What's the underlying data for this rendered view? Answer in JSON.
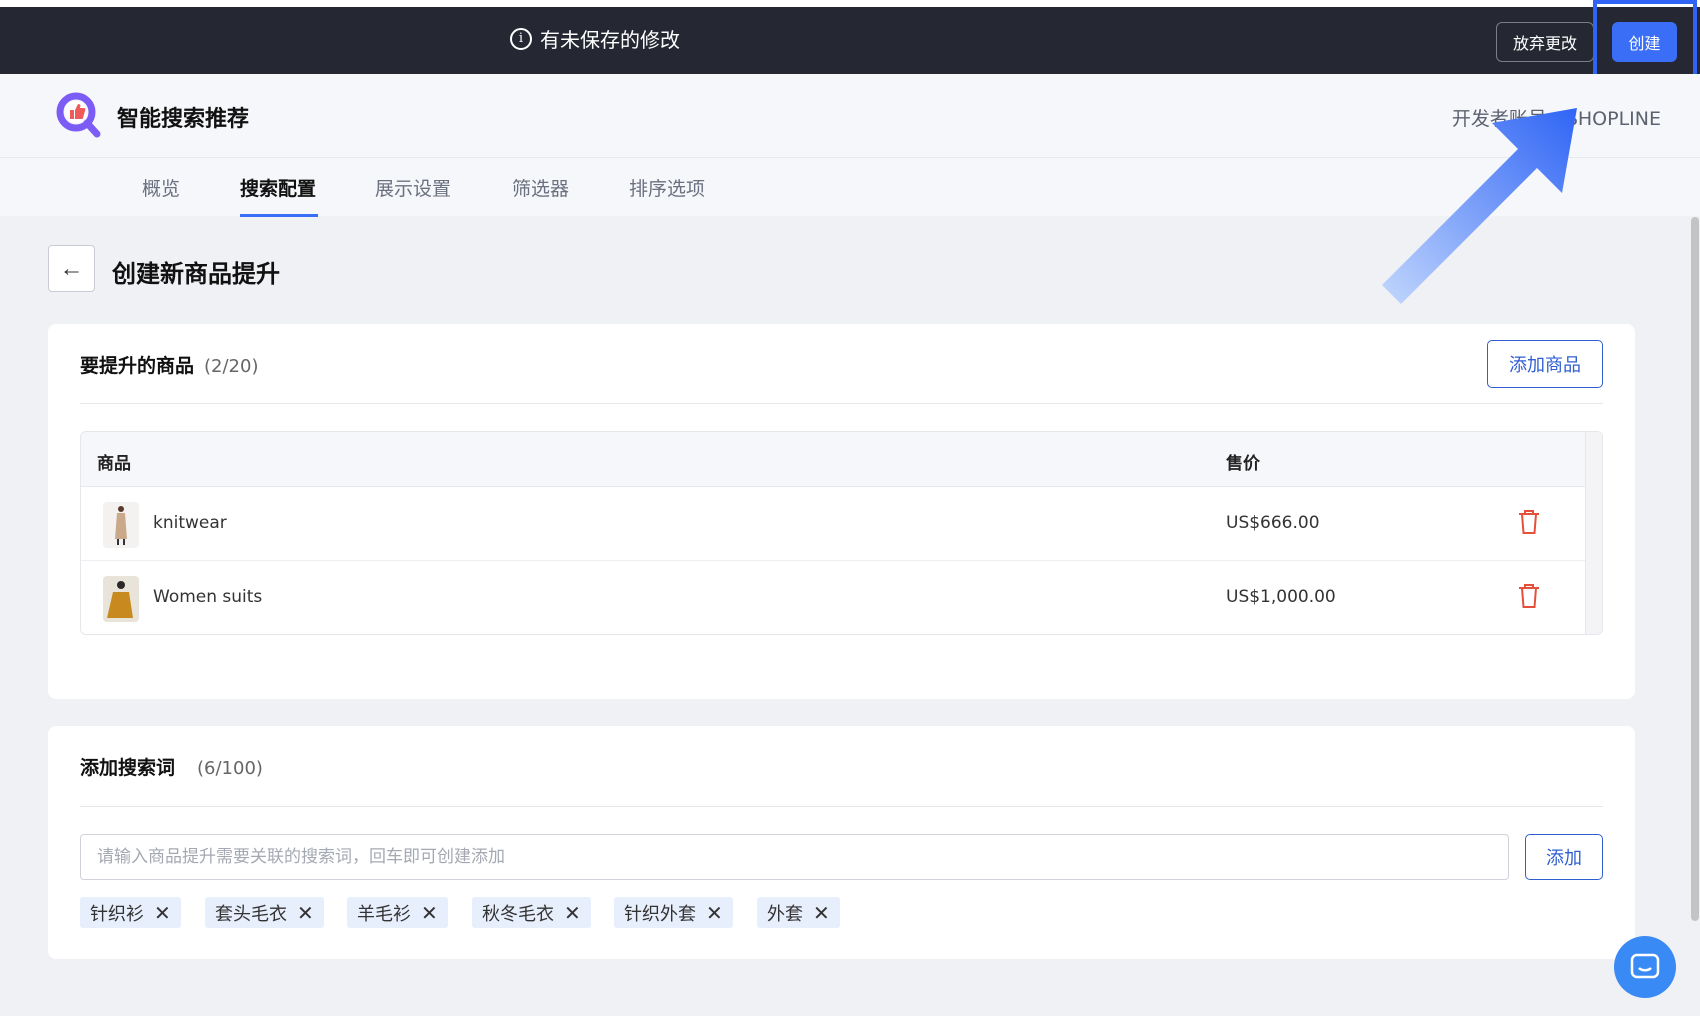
{
  "topbar": {
    "unsaved_text": "有未保存的修改",
    "discard_label": "放弃更改",
    "create_label": "创建"
  },
  "header": {
    "app_title": "智能搜索推荐",
    "developer": "开发者账号：SHOPLINE"
  },
  "tabs": [
    {
      "label": "概览"
    },
    {
      "label": "搜索配置",
      "active": true
    },
    {
      "label": "展示设置"
    },
    {
      "label": "筛选器"
    },
    {
      "label": "排序选项"
    }
  ],
  "page": {
    "title": "创建新商品提升"
  },
  "products_card": {
    "title": "要提升的商品",
    "count": "(2/20)",
    "add_label": "添加商品",
    "columns": [
      "商品",
      "售价"
    ],
    "rows": [
      {
        "name": "knitwear",
        "price": "US$666.00"
      },
      {
        "name": "Women suits",
        "price": "US$1,000.00"
      }
    ]
  },
  "keywords_card": {
    "title": "添加搜索词",
    "count": "(6/100)",
    "placeholder": "请输入商品提升需要关联的搜索词，回车即可创建添加",
    "add_label": "添加",
    "tags": [
      "针织衫",
      "套头毛衣",
      "羊毛衫",
      "秋冬毛衣",
      "针织外套",
      "外套"
    ]
  },
  "colors": {
    "accent": "#3a6ef6",
    "topbar": "#252833",
    "delete": "#e4503a"
  }
}
